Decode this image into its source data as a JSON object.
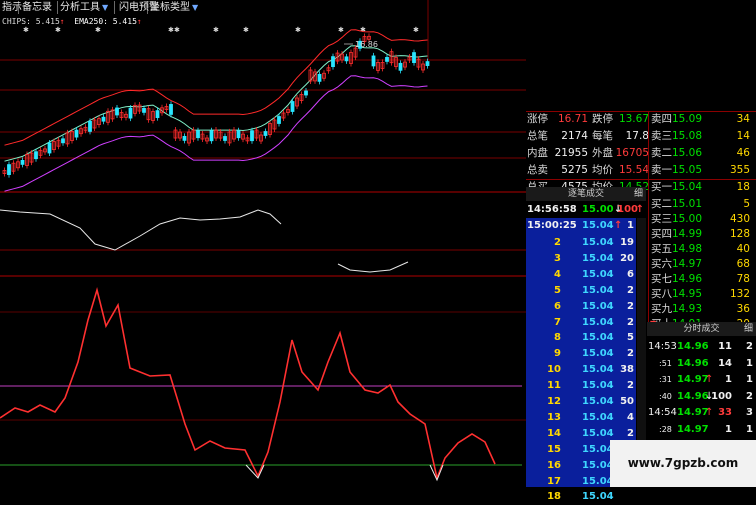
{
  "toolbar": {
    "items": [
      "指示",
      "备忘录",
      "分析工具",
      "闪电预警",
      "坐标类型"
    ]
  },
  "indicator": {
    "chips_label": "CHIPS: 5.415",
    "chips_arrow": "↑",
    "ema_label": "EMA250: 5.415",
    "ema_arrow": "↑"
  },
  "chart": {
    "peak_label": "16.86",
    "colors": {
      "up": "#ff2d2d",
      "down": "#29e6ff",
      "upper_band": "#ff2a2a",
      "mid_band": "#7ff0c8",
      "lower_band": "#d040ff",
      "osc": "#ff3030",
      "ref_line": "#c040c0",
      "zero_line": "#2aa02a"
    }
  },
  "quote": {
    "rows": [
      {
        "l1": "涨停",
        "v1": "16.71",
        "c1": "red",
        "l2": "跌停",
        "v2": "13.67",
        "c2": "green",
        "l3": "卖四",
        "v3": "15.09",
        "c3": "green",
        "v4": "34"
      },
      {
        "l1": "总笔",
        "v1": "2174",
        "c1": "wht",
        "l2": "每笔",
        "v2": "17.8",
        "c2": "wht",
        "l3": "卖三",
        "v3": "15.08",
        "c3": "green",
        "v4": "14"
      },
      {
        "l1": "内盘",
        "v1": "21955",
        "c1": "wht",
        "l2": "外盘",
        "v2": "16705",
        "c2": "red",
        "l3": "卖二",
        "v3": "15.06",
        "c3": "green",
        "v4": "46"
      },
      {
        "l1": "总卖",
        "v1": "5275",
        "c1": "wht",
        "l2": "均价",
        "v2": "15.54",
        "c2": "red",
        "l3": "卖一",
        "v3": "15.05",
        "c3": "green",
        "v4": "355"
      },
      {
        "l1": "总买",
        "v1": "4575",
        "c1": "wht",
        "l2": "均价",
        "v2": "14.52",
        "c2": "green",
        "l3": "买一",
        "v3": "15.04",
        "c3": "green",
        "v4": "18"
      }
    ],
    "bids_more": [
      {
        "l": "买二",
        "p": "15.01",
        "v": "5"
      },
      {
        "l": "买三",
        "p": "15.00",
        "v": "430"
      },
      {
        "l": "买四",
        "p": "14.99",
        "v": "128"
      },
      {
        "l": "买五",
        "p": "14.98",
        "v": "40"
      },
      {
        "l": "买六",
        "p": "14.97",
        "v": "68"
      },
      {
        "l": "买七",
        "p": "14.96",
        "v": "78"
      },
      {
        "l": "买八",
        "p": "14.95",
        "v": "132"
      },
      {
        "l": "买九",
        "p": "14.93",
        "v": "36"
      },
      {
        "l": "买十",
        "p": "14.91",
        "v": "20",
        "arrow": "▼"
      }
    ]
  },
  "ticks_left": {
    "header": "逐笔成交",
    "header_right": "细",
    "first": {
      "time": "14:56:58",
      "price": "15.00",
      "arrow": "↓",
      "vol": "100",
      "vol_arrow": "↑"
    },
    "second": {
      "time": "15:00:25",
      "price": "15.04",
      "arrow": "↑",
      "vol": "1"
    },
    "rows": [
      {
        "n": "2",
        "p": "15.04",
        "v": "19"
      },
      {
        "n": "3",
        "p": "15.04",
        "v": "20"
      },
      {
        "n": "4",
        "p": "15.04",
        "v": "6"
      },
      {
        "n": "5",
        "p": "15.04",
        "v": "2"
      },
      {
        "n": "6",
        "p": "15.04",
        "v": "2"
      },
      {
        "n": "7",
        "p": "15.04",
        "v": "2"
      },
      {
        "n": "8",
        "p": "15.04",
        "v": "5"
      },
      {
        "n": "9",
        "p": "15.04",
        "v": "2"
      },
      {
        "n": "10",
        "p": "15.04",
        "v": "38"
      },
      {
        "n": "11",
        "p": "15.04",
        "v": "2"
      },
      {
        "n": "12",
        "p": "15.04",
        "v": "50"
      },
      {
        "n": "13",
        "p": "15.04",
        "v": "4"
      },
      {
        "n": "14",
        "p": "15.04",
        "v": "2"
      },
      {
        "n": "15",
        "p": "15.04",
        "v": "2"
      },
      {
        "n": "16",
        "p": "15.04",
        "v": "2"
      },
      {
        "n": "17",
        "p": "15.04",
        "v": "9"
      },
      {
        "n": "18",
        "p": "15.04",
        "v": ""
      }
    ]
  },
  "ticks_right": {
    "header": "分时成交",
    "header_right": "细",
    "rows": [
      {
        "t": "14:53",
        "p": "14.96",
        "pa": "",
        "v": "11",
        "n": "2"
      },
      {
        "t": ":51",
        "p": "14.96",
        "pa": "",
        "v": "14",
        "n": "1"
      },
      {
        "t": ":31",
        "p": "14.97",
        "pa": "↑",
        "v": "1",
        "n": "1"
      },
      {
        "t": ":40",
        "p": "14.96",
        "pa": "↓",
        "v": "100",
        "n": "2"
      },
      {
        "t": "14:54",
        "p": "14.97",
        "pa": "↑",
        "v": "33",
        "n": "3"
      },
      {
        "t": ":28",
        "p": "14.97",
        "pa": "",
        "v": "1",
        "n": "1"
      },
      {
        "t": ":43",
        "p": "14.97",
        "pa": "",
        "v": "37",
        "n": "3"
      }
    ]
  },
  "watermark": {
    "text": "www.7gpzb.com"
  }
}
